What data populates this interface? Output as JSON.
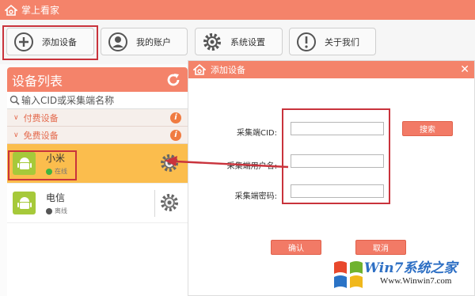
{
  "app": {
    "title": "掌上看家"
  },
  "toolbar": {
    "buttons": [
      {
        "label": "添加设备",
        "icon": "plus-circle-icon"
      },
      {
        "label": "我的账户",
        "icon": "user-icon"
      },
      {
        "label": "系统设置",
        "icon": "gear-icon"
      },
      {
        "label": "关于我们",
        "icon": "exclamation-circle-icon"
      }
    ]
  },
  "device_panel": {
    "title": "设备列表",
    "search_placeholder": "输入CID或采集端名称",
    "groups": [
      {
        "label": "付费设备"
      },
      {
        "label": "免费设备"
      }
    ],
    "devices": [
      {
        "name": "小米",
        "status": "在线",
        "status_color": "#3fb53f",
        "selected": true
      },
      {
        "name": "电信",
        "status": "离线",
        "status_color": "#555555",
        "selected": false
      }
    ]
  },
  "dialog": {
    "title": "添加设备",
    "fields": [
      {
        "label": "采集端CID:",
        "value": ""
      },
      {
        "label": "采集端用户名:",
        "value": ""
      },
      {
        "label": "采集端密码:",
        "value": ""
      }
    ],
    "search_button": "搜索",
    "confirm_button": "确认",
    "cancel_button": "取消"
  },
  "watermark": {
    "brand": "Win7系统之家",
    "url": "Www.Winwin7.com"
  },
  "colors": {
    "accent": "#f4836a",
    "selected_row": "#fbbd4d",
    "highlight": "#c9333c",
    "android": "#a6c93a"
  }
}
